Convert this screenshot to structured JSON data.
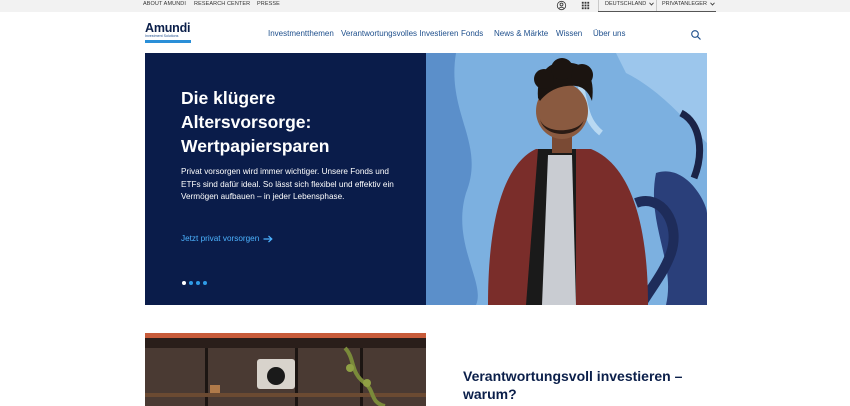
{
  "utility_bar": {
    "links": [
      "ABOUT AMUNDI",
      "RESEARCH CENTER",
      "PRESSE"
    ],
    "icons": [
      "user-icon",
      "apps-grid-icon"
    ],
    "country": "DEUTSCHLAND",
    "audience": "PRIVATANLEGER"
  },
  "brand": {
    "name": "Amundi",
    "tagline": "Investment Solutions",
    "colors": {
      "navy": "#0a1c4a",
      "accent_blue": "#2a8fd8",
      "link_blue": "#1e4f8c",
      "hero_link": "#4cb3ff"
    }
  },
  "nav": {
    "items": [
      "Investmentthemen",
      "Verantwortungsvolles Investieren",
      "Fonds",
      "News & Märkte",
      "Wissen",
      "Über uns"
    ],
    "search_icon": "search-icon"
  },
  "hero": {
    "title": "Die klügere Altersvorsorge: Wertpapiersparen",
    "text": "Privat vorsorgen wird immer wichtiger. Unsere Fonds und ETFs sind dafür ideal. So lässt sich flexibel und effektiv ein Vermögen aufbauen – in jeder Lebensphase.",
    "link_label": "Jetzt privat vorsorgen",
    "slides_count": 4,
    "active_slide": 1
  },
  "section2": {
    "title": "Verantwortungsvoll investieren – warum?"
  }
}
